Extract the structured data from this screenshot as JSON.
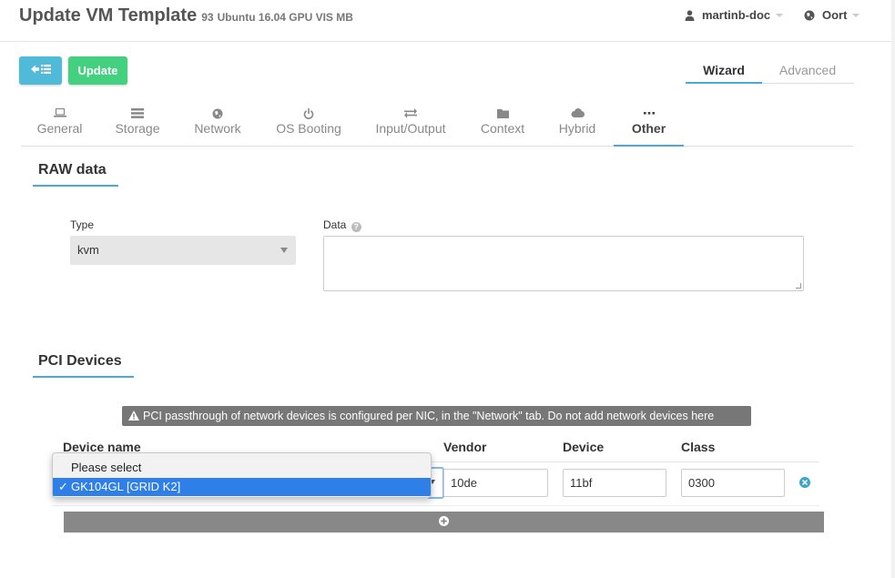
{
  "header": {
    "title": "Update VM Template",
    "template_id": "93",
    "template_name": "Ubuntu 16.04 GPU VIS MB",
    "user": "martinb-doc",
    "zone": "Oort"
  },
  "toolbar": {
    "back_icon": "arrow-left-list-icon",
    "update_label": "Update"
  },
  "mode_tabs": [
    "Wizard",
    "Advanced"
  ],
  "tabs": [
    {
      "label": "General",
      "icon": "laptop-icon"
    },
    {
      "label": "Storage",
      "icon": "tasks-icon"
    },
    {
      "label": "Network",
      "icon": "globe-icon"
    },
    {
      "label": "OS Booting",
      "icon": "power-icon"
    },
    {
      "label": "Input/Output",
      "icon": "exchange-icon"
    },
    {
      "label": "Context",
      "icon": "folder-icon"
    },
    {
      "label": "Hybrid",
      "icon": "cloud-icon"
    },
    {
      "label": "Other",
      "icon": "ellipsis-icon",
      "active": true
    }
  ],
  "raw": {
    "section_title": "RAW data",
    "type_label": "Type",
    "type_value": "kvm",
    "data_label": "Data",
    "data_value": ""
  },
  "pci": {
    "section_title": "PCI Devices",
    "notice": "PCI passthrough of network devices is configured per NIC, in the \"Network\" tab. Do not add network devices here",
    "columns": {
      "device_name": "Device name",
      "vendor": "Vendor",
      "device": "Device",
      "class": "Class"
    },
    "row": {
      "vendor": "10de",
      "device": "11bf",
      "class": "0300"
    },
    "dropdown_options": [
      "Please select",
      "GK104GL [GRID K2]"
    ],
    "selected_option": "GK104GL [GRID K2]",
    "check_mark": "✓"
  },
  "colors": {
    "accent": "#4aa9d8",
    "back_button": "#50bbd9",
    "update_button": "#43d07f",
    "select_highlight": "#2f7fe8"
  }
}
